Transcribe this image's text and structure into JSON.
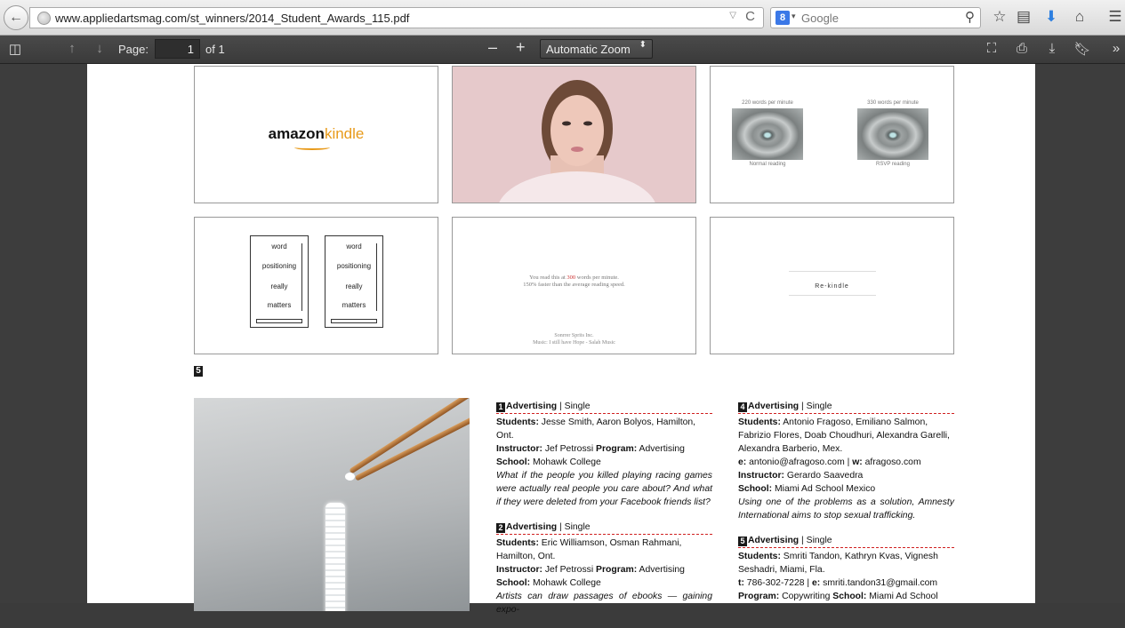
{
  "browser": {
    "back": "←",
    "url": "www.appliedartsmag.com/st_winners/2014_Student_Awards_115.pdf",
    "url_dropdown": "▽",
    "reload": "C",
    "search_engine_badge": "8",
    "search_engine_dropdown": "▾",
    "search_placeholder": "Google",
    "search_icon": "search-icon",
    "toolbar_icons": [
      "star-icon",
      "reading-list-icon",
      "download-arrow-icon",
      "home-icon",
      "menu-icon"
    ]
  },
  "pdf_toolbar": {
    "sidebar_toggle": "sidebar-toggle-icon",
    "prev": "↑",
    "next": "↓",
    "page_label": "Page:",
    "page_value": "1",
    "page_of": "of 1",
    "zoom_minus": "–",
    "zoom_plus": "+",
    "zoom_value": "Automatic Zoom",
    "zoom_arrow": "⬍",
    "presentation": "⛶",
    "print": "⎙",
    "download": "⤓",
    "bookmark": "bookmark-icon",
    "tools": "»"
  },
  "thumbs": {
    "t1": {
      "amazon": "amazon",
      "kindle": "kindle"
    },
    "t3": {
      "left_caption": "220 words per minute",
      "right_caption": "330 words per minute",
      "left_label": "Normal reading",
      "right_label": "RSVP reading"
    },
    "t4": {
      "words": [
        "word",
        "positioning",
        "really",
        "matters"
      ]
    },
    "t5": {
      "line1_pre": "You read this at ",
      "line1_num": "300",
      "line1_post": " words per minute.",
      "line2": "150% faster than the average reading speed.",
      "credit1": "Sonrrer Sprits Inc.",
      "credit2": "Music: I still have Hope - Salah Music"
    },
    "t6": {
      "text": "Re-kindle"
    }
  },
  "section_number": "5",
  "entries": [
    {
      "num": "1",
      "category": "Advertising",
      "type": " | Single",
      "students_label": "Students:",
      "students": " Jesse Smith, Aaron Bolyos, Hamilton, Ont.",
      "instructor_label": "Instructor:",
      "instructor": " Jef Petrossi ",
      "program_label": "Program:",
      "program": " Advertising",
      "school_label": "School:",
      "school": " Mohawk College",
      "desc": "What if the people you killed playing racing games were actually real people you care about? And what if they were deleted from your Facebook friends list?"
    },
    {
      "num": "2",
      "category": "Advertising",
      "type": " | Single",
      "students_label": "Students:",
      "students": " Eric Williamson, Osman Rahmani, Hamilton, Ont.",
      "instructor_label": "Instructor:",
      "instructor": " Jef Petrossi ",
      "program_label": "Program:",
      "program": " Advertising",
      "school_label": "School:",
      "school": " Mohawk College",
      "desc": "Artists can draw passages of ebooks — gaining expo-"
    },
    {
      "num": "4",
      "category": "Advertising",
      "type": " | Single",
      "students_label": "Students:",
      "students": " Antonio Fragoso, Emiliano Salmon, Fabrizio Flores, Doab Choudhuri, Alexandra Garelli, Alexandra Barberio, Mex.",
      "email_label": "e:",
      "email": " antonio@afragoso.com",
      "sep": " | ",
      "web_label": "w:",
      "web": " afragoso.com",
      "instructor_label": "Instructor:",
      "instructor": " Gerardo Saavedra",
      "school_label": "School:",
      "school": " Miami Ad School Mexico",
      "desc": "Using one of the problems as a solution, Amnesty International aims to stop sexual trafficking."
    },
    {
      "num": "5",
      "category": "Advertising",
      "type": " | Single",
      "students_label": "Students:",
      "students": " Smriti Tandon, Kathryn Kvas, Vignesh Seshadri, Miami, Fla.",
      "tel_label": "t:",
      "tel": " 786-302-7228",
      "sep": " | ",
      "email_label": "e:",
      "email": " smriti.tandon31@gmail.com",
      "program_label": "Program:",
      "program": " Copywriting ",
      "school_label": "School:",
      "school": " Miami Ad School"
    }
  ]
}
